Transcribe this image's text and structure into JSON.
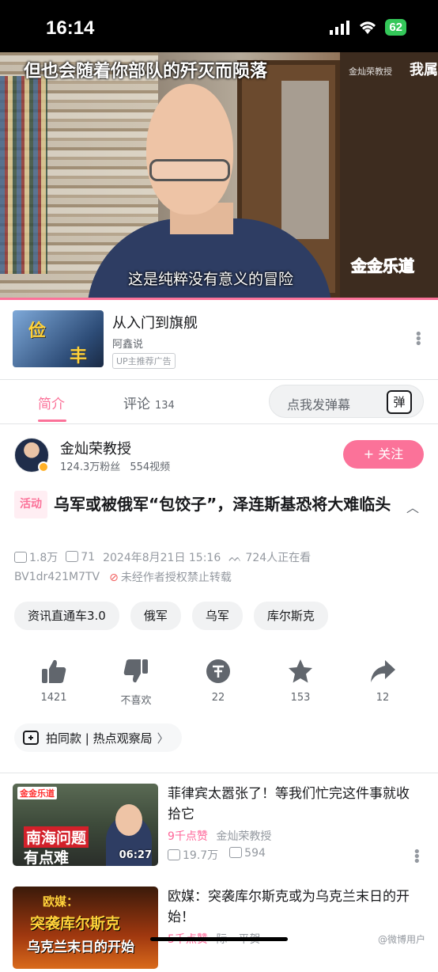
{
  "status_bar": {
    "time": "16:14",
    "battery": "62"
  },
  "player": {
    "subtitle_top": "但也会随着你部队的歼灭而陨落",
    "subtitle_bottom": "这是纯粹没有意义的冒险",
    "badge": "金灿荣教授",
    "overlay_right": "我属",
    "channel_logo": "金金乐道",
    "progress": 1.0
  },
  "ad": {
    "title": "从入门到旗舰",
    "author": "阿鑫说",
    "tag": "UP主推荐广告",
    "thumb_text": [
      "俭",
      "丰"
    ]
  },
  "tabs": [
    {
      "label": "简介",
      "active": true
    },
    {
      "label": "评论",
      "count": "134",
      "active": false
    }
  ],
  "danmu": {
    "placeholder": "点我发弹幕",
    "icon_label": "弹"
  },
  "uploader": {
    "name": "金灿荣教授",
    "fans": "124.3万粉丝",
    "videos": "554视频",
    "follow_label": "+ 关注"
  },
  "video": {
    "activity_tag": "活动",
    "title": "乌军或被俄军“包饺子”，泽连斯基恐将大难临头",
    "plays": "1.8万",
    "danmaku": "71",
    "date": "2024年8月21日 15:16",
    "watching": "724人正在看",
    "bvid": "BV1dr421M7TV",
    "reprint_notice": "未经作者授权禁止转载"
  },
  "tags": [
    "资讯直通车3.0",
    "俄军",
    "乌军",
    "库尔斯克"
  ],
  "actions": [
    {
      "icon": "thumbs-up-icon",
      "label": "1421"
    },
    {
      "icon": "thumbs-down-icon",
      "label": "不喜欢"
    },
    {
      "icon": "coin-icon",
      "label": "22"
    },
    {
      "icon": "star-icon",
      "label": "153"
    },
    {
      "icon": "share-icon",
      "label": "12"
    }
  ],
  "same_style": {
    "label": "拍同款 | 热点观察局"
  },
  "recommendations": [
    {
      "title": "菲律宾太嚣张了！等我们忙完这件事就收拾它",
      "likes": "9千点赞",
      "author": "金灿荣教授",
      "plays": "19.7万",
      "comments": "594",
      "duration": "06:27",
      "thumb_logo": "金金乐道",
      "thumb_text": [
        "南海问题",
        "有点难"
      ]
    },
    {
      "title": "欧媒：突袭库尔斯克或为乌克兰末日的开始！",
      "likes": "5千点赞",
      "author": "际一平贺",
      "thumb_text": [
        "欧媒：",
        "突袭库尔斯克",
        "乌克兰末日的开始"
      ]
    }
  ],
  "watermark": "@微博用户"
}
